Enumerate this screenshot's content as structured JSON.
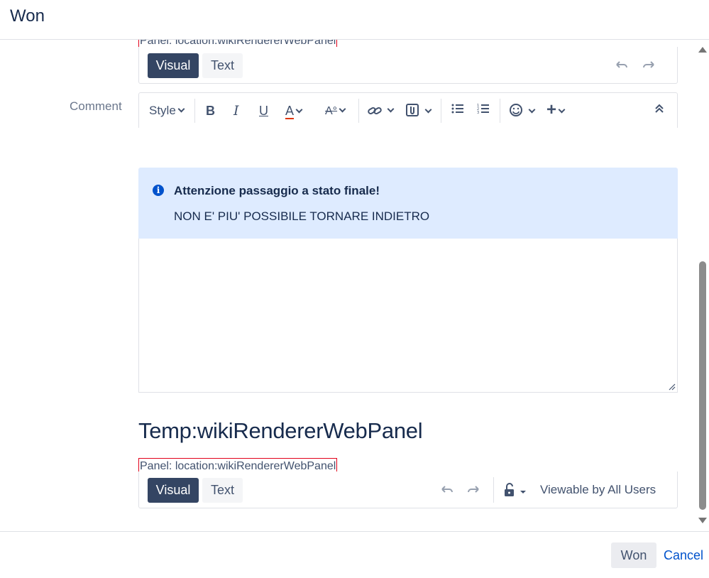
{
  "dialog": {
    "title": "Won"
  },
  "top_panel": {
    "label": "Panel: location:wikiRendererWebPanel",
    "visual_label": "Visual",
    "text_label": "Text"
  },
  "comment": {
    "label": "Comment",
    "toolbar": {
      "style_label": "Style",
      "icons": [
        "bold-icon",
        "italic-icon",
        "underline-icon",
        "text-color-icon",
        "text-effects-icon",
        "link-icon",
        "attachment-icon",
        "bullet-list-icon",
        "numbered-list-icon",
        "emoji-icon",
        "insert-more-icon",
        "collapse-toolbar-icon"
      ]
    }
  },
  "info_panel": {
    "title": "Attenzione passaggio a stato finale!",
    "body": "NON E' PIU' POSSIBILE TORNARE INDIETRO",
    "color": "#deebff",
    "icon_color": "#0052cc"
  },
  "temp_section": {
    "title": "Temp:wikiRendererWebPanel",
    "panel_label": "Panel: location:wikiRendererWebPanel",
    "visual_label": "Visual",
    "text_label": "Text",
    "visibility_label": "Viewable by All Users"
  },
  "footer": {
    "won_label": "Won",
    "cancel_label": "Cancel"
  },
  "colors": {
    "primary_dark": "#344563",
    "link": "#0052cc",
    "panel_border": "#e2001a"
  }
}
